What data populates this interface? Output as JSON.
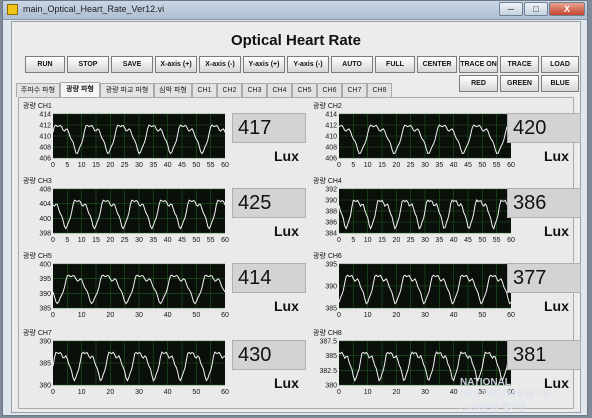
{
  "window": {
    "title": "main_Optical_Heart_Rate_Ver12.vi",
    "buttons": [
      "─",
      "□",
      "X"
    ]
  },
  "panel_title": "Optical Heart Rate",
  "toolbar": [
    {
      "label": "RUN"
    },
    {
      "label": "STOP"
    },
    {
      "label": "SAVE"
    },
    {
      "label": "X-axis (+)"
    },
    {
      "label": "X-axis (-)"
    },
    {
      "label": "Y-axis (+)"
    },
    {
      "label": "Y-axis (-)"
    },
    {
      "label": "AUTO"
    },
    {
      "label": "FULL"
    },
    {
      "label": "CENTER"
    },
    {
      "label": "TRACE ON"
    },
    {
      "label": "TRACE OFF"
    },
    {
      "label": "LOAD VIEW"
    },
    {
      "label": "RED"
    },
    {
      "label": "GREEN"
    },
    {
      "label": "BLUE"
    }
  ],
  "tabs": [
    "주파수 파형",
    "광량 파형",
    "광량 파교 파형",
    "심박 파형",
    "CH1",
    "CH2",
    "CH3",
    "CH4",
    "CH5",
    "CH6",
    "CH7",
    "CH8"
  ],
  "active_tab": "광량 파형",
  "unit_label": "Lux",
  "channels": [
    {
      "label": "광량 CH1",
      "value": "417",
      "yticks": [
        "414",
        "412",
        "410",
        "408",
        "406"
      ]
    },
    {
      "label": "광량 CH2",
      "value": "420",
      "yticks": [
        "414",
        "412",
        "410",
        "408",
        "406"
      ]
    },
    {
      "label": "광량 CH3",
      "value": "425",
      "yticks": [
        "408",
        "404",
        "400",
        "398"
      ]
    },
    {
      "label": "광량 CH4",
      "value": "386",
      "yticks": [
        "392",
        "390",
        "388",
        "386",
        "384"
      ]
    },
    {
      "label": "광량 CH5",
      "value": "414",
      "yticks": [
        "400",
        "395",
        "390",
        "385"
      ]
    },
    {
      "label": "광량 CH6",
      "value": "377",
      "yticks": [
        "395",
        "390",
        "385"
      ]
    },
    {
      "label": "광량 CH7",
      "value": "430",
      "yticks": [
        "390",
        "385",
        "380"
      ]
    },
    {
      "label": "광량 CH8",
      "value": "381",
      "yticks": [
        "387.5",
        "385",
        "382.5",
        "380"
      ]
    }
  ],
  "xticks": [
    "0",
    "5",
    "10",
    "15",
    "20",
    "25",
    "30",
    "35",
    "40",
    "45",
    "50",
    "55",
    "60"
  ],
  "xticks_short": [
    "0",
    "10",
    "20",
    "30",
    "40",
    "50",
    "60"
  ],
  "colors": {
    "plot_bg": "#0a0f0a",
    "grid": "#1f5a1f",
    "trace": "#f4f4f4"
  },
  "watermark": {
    "line1": "NATIONAL",
    "line2": "INSTRUMENTS",
    "line3": "LabVIEW 평가판"
  }
}
